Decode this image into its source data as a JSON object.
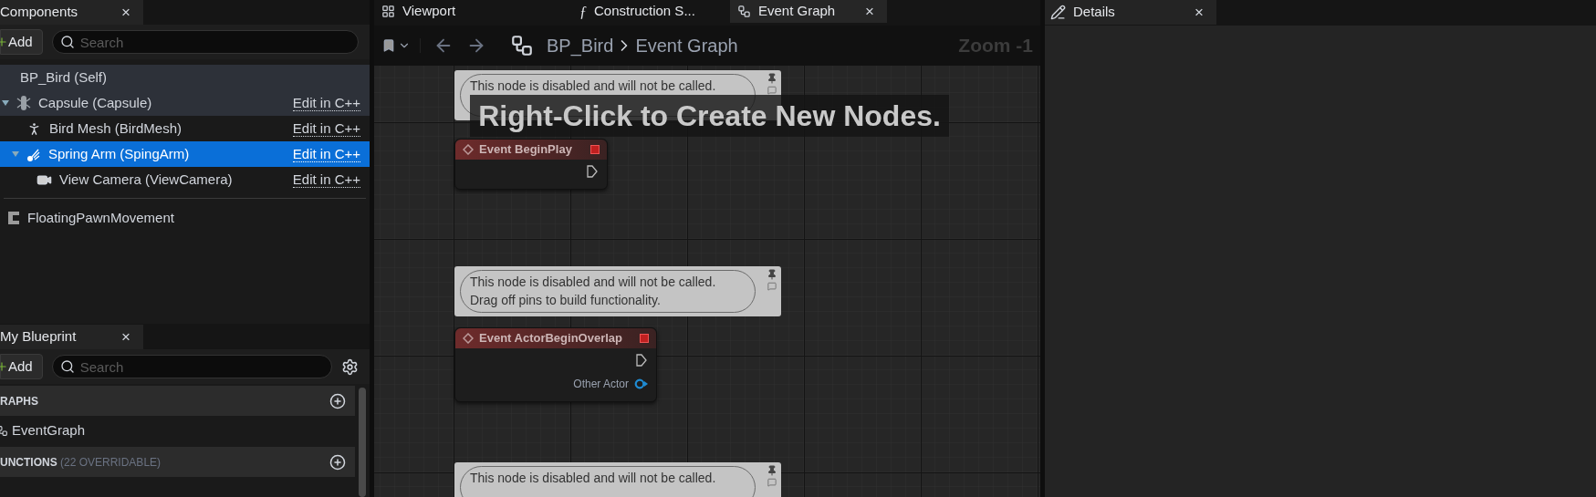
{
  "components_panel": {
    "tab": {
      "label": "Components",
      "close": "×"
    },
    "add_button": "Add",
    "search": {
      "placeholder": "Search"
    },
    "tree": [
      {
        "label": "BP_Bird (Self)",
        "highlighted": true,
        "selected": false,
        "children": [
          {
            "label": "Capsule (Capsule)",
            "kind": "capsule",
            "highlighted": true,
            "selected": false,
            "expanded": true,
            "action": "Edit in C++",
            "children": [
              {
                "label": "Bird Mesh (BirdMesh)",
                "kind": "mesh",
                "highlighted": false,
                "selected": false,
                "action": "Edit in C++"
              },
              {
                "label": "Spring Arm (SpingArm)",
                "kind": "spring-arm",
                "highlighted": false,
                "selected": true,
                "expanded": true,
                "action": "Edit in C++",
                "children": [
                  {
                    "label": "View Camera (ViewCamera)",
                    "kind": "camera",
                    "highlighted": false,
                    "selected": false,
                    "action": "Edit in C++"
                  }
                ]
              }
            ]
          }
        ]
      }
    ],
    "extra_components": [
      {
        "label": "FloatingPawnMovement"
      }
    ]
  },
  "my_blueprint_panel": {
    "tab": {
      "label": "My Blueprint",
      "close": "×"
    },
    "add_button": "Add",
    "search": {
      "placeholder": "Search"
    },
    "sections": [
      {
        "title": "RAPHS",
        "items": [
          {
            "label": "EventGraph"
          }
        ]
      },
      {
        "title": "UNCTIONS",
        "note": "(22 OVERRIDABLE)"
      }
    ]
  },
  "graph_editor": {
    "tabs": [
      {
        "label": "Viewport",
        "kind": "viewport",
        "selected": false
      },
      {
        "label": "Construction S...",
        "kind": "function",
        "icon_char": "ƒ",
        "selected": false
      },
      {
        "label": "Event Graph",
        "kind": "graph",
        "selected": true,
        "close": "×"
      }
    ],
    "breadcrumb": [
      "BP_Bird",
      "Event Graph"
    ],
    "zoom": "Zoom -1",
    "hint": "Right-Click to Create New Nodes.",
    "nodes": [
      {
        "comment": [
          "This node is disabled and will not be called."
        ],
        "title": "Event BeginPlay",
        "pins": [
          {
            "kind": "exec"
          }
        ]
      },
      {
        "comment": [
          "This node is disabled and will not be called.",
          "Drag off pins to build functionality."
        ],
        "title": "Event ActorBeginOverlap",
        "pins": [
          {
            "kind": "exec"
          },
          {
            "kind": "object",
            "label": "Other Actor"
          }
        ]
      },
      {
        "comment": [
          "This node is disabled and will not be called."
        ]
      }
    ]
  },
  "details_panel": {
    "tab": {
      "label": "Details",
      "close": "×"
    }
  }
}
